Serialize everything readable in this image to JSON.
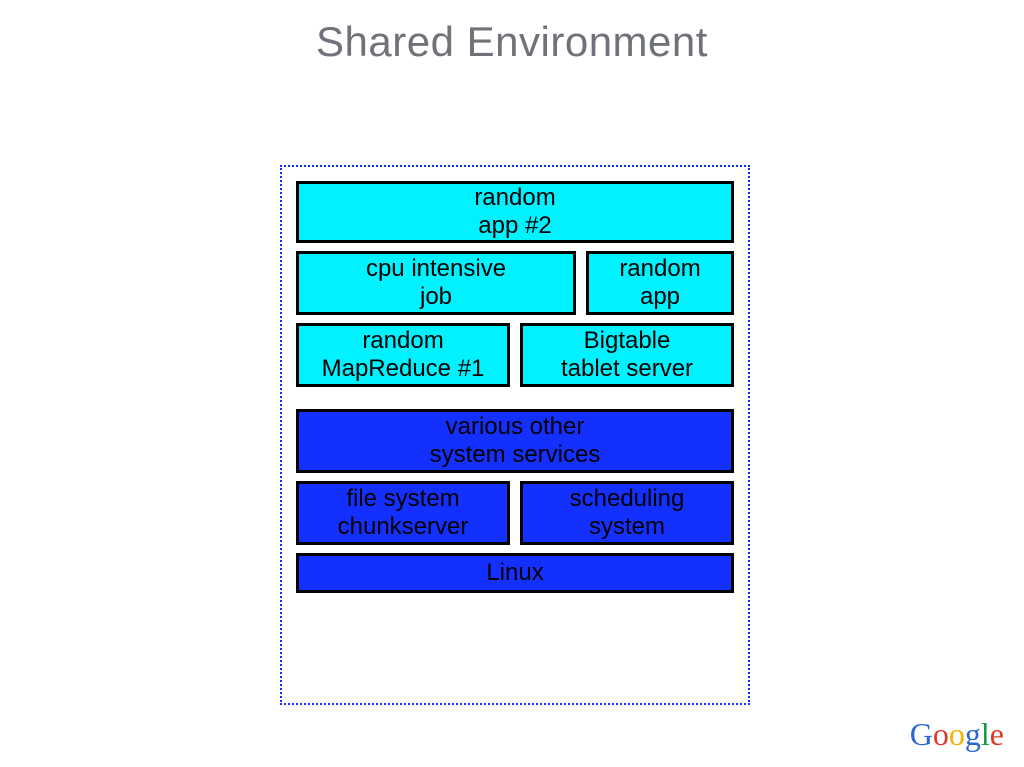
{
  "title": "Shared Environment",
  "blocks": {
    "random_app_2": {
      "line1": "random",
      "line2": "app #2"
    },
    "cpu_intensive": {
      "line1": "cpu intensive",
      "line2": "job"
    },
    "random_app": {
      "line1": "random",
      "line2": "app"
    },
    "mapreduce": {
      "line1": "random",
      "line2": "MapReduce #1"
    },
    "bigtable": {
      "line1": "Bigtable",
      "line2": "tablet server"
    },
    "other_services": {
      "line1": "various other",
      "line2": "system services"
    },
    "chunkserver": {
      "line1": "file system",
      "line2": "chunkserver"
    },
    "scheduling": {
      "line1": "scheduling",
      "line2": "system"
    },
    "linux": {
      "line1": "Linux"
    }
  },
  "logo": {
    "c1": "G",
    "c2": "o",
    "c3": "o",
    "c4": "g",
    "c5": "l",
    "c6": "e"
  },
  "colors": {
    "cyan": "#00f2ff",
    "blue": "#1430ff",
    "border_dotted": "#1030ff"
  }
}
